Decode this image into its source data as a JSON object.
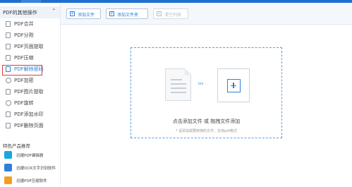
{
  "sidebar": {
    "header": {
      "title": "PDF的其他操作"
    },
    "items": [
      {
        "label": "PDF合并"
      },
      {
        "label": "PDF分割"
      },
      {
        "label": "PDF页面提取"
      },
      {
        "label": "PDF压缩"
      },
      {
        "label": "PDF解除密码"
      },
      {
        "label": "PDF加密"
      },
      {
        "label": "PDF图片提取"
      },
      {
        "label": "PDF旋转"
      },
      {
        "label": "PDF添加水印"
      },
      {
        "label": "PDF删除页面"
      }
    ],
    "products_title": "特色产品推荐",
    "products": [
      {
        "label": "迅捷PDF编辑器",
        "color": "#1aa7e0"
      },
      {
        "label": "迅捷OCR文字识别软件",
        "color": "#2f7fd8"
      },
      {
        "label": "迅捷PDF压缩软件",
        "color": "#f0a020"
      }
    ]
  },
  "toolbar": {
    "add_file": "添加文件",
    "add_folder": "添加文件夹",
    "clear_list": "清空列表"
  },
  "dropzone": {
    "main_text": "点击添加文件 或 拖拽文件添加",
    "sub_text": "* 请添加需要转换的文件，支持pdf格式"
  },
  "colors": {
    "accent": "#2f7fd8",
    "highlight": "#e23a3a",
    "titlebar": "#1f6fd0"
  }
}
